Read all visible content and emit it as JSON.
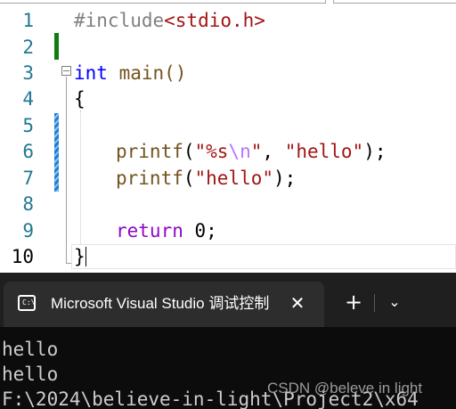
{
  "editor": {
    "line_numbers": [
      "1",
      "2",
      "3",
      "4",
      "5",
      "6",
      "7",
      "8",
      "9",
      "10"
    ],
    "line1": {
      "directive": "#include",
      "header": "<stdio.h>"
    },
    "line3": {
      "type": "int",
      "name": " main()"
    },
    "line4": {
      "brace": "{"
    },
    "line6": {
      "fn": "printf",
      "open": "(",
      "str_a": "\"%s",
      "esc": "\\n",
      "str_b": "\"",
      "sep": ", ",
      "str2": "\"hello\"",
      "close": ");"
    },
    "line7": {
      "fn": "printf",
      "open": "(",
      "str": "\"hello\"",
      "close": ");"
    },
    "line9": {
      "kw": "return",
      "rest": " 0;"
    },
    "line10": {
      "brace": "}"
    }
  },
  "terminal": {
    "tab_icon_text": "C:\\",
    "tab_title": "Microsoft Visual Studio 调试控制台",
    "tab_close": "✕",
    "new_tab": "+",
    "dropdown": "⌄",
    "output": [
      "hello",
      "hello",
      "F:\\2024\\believe-in-light\\Project2\\x64"
    ]
  },
  "watermark": "CSDN @beleve in light"
}
